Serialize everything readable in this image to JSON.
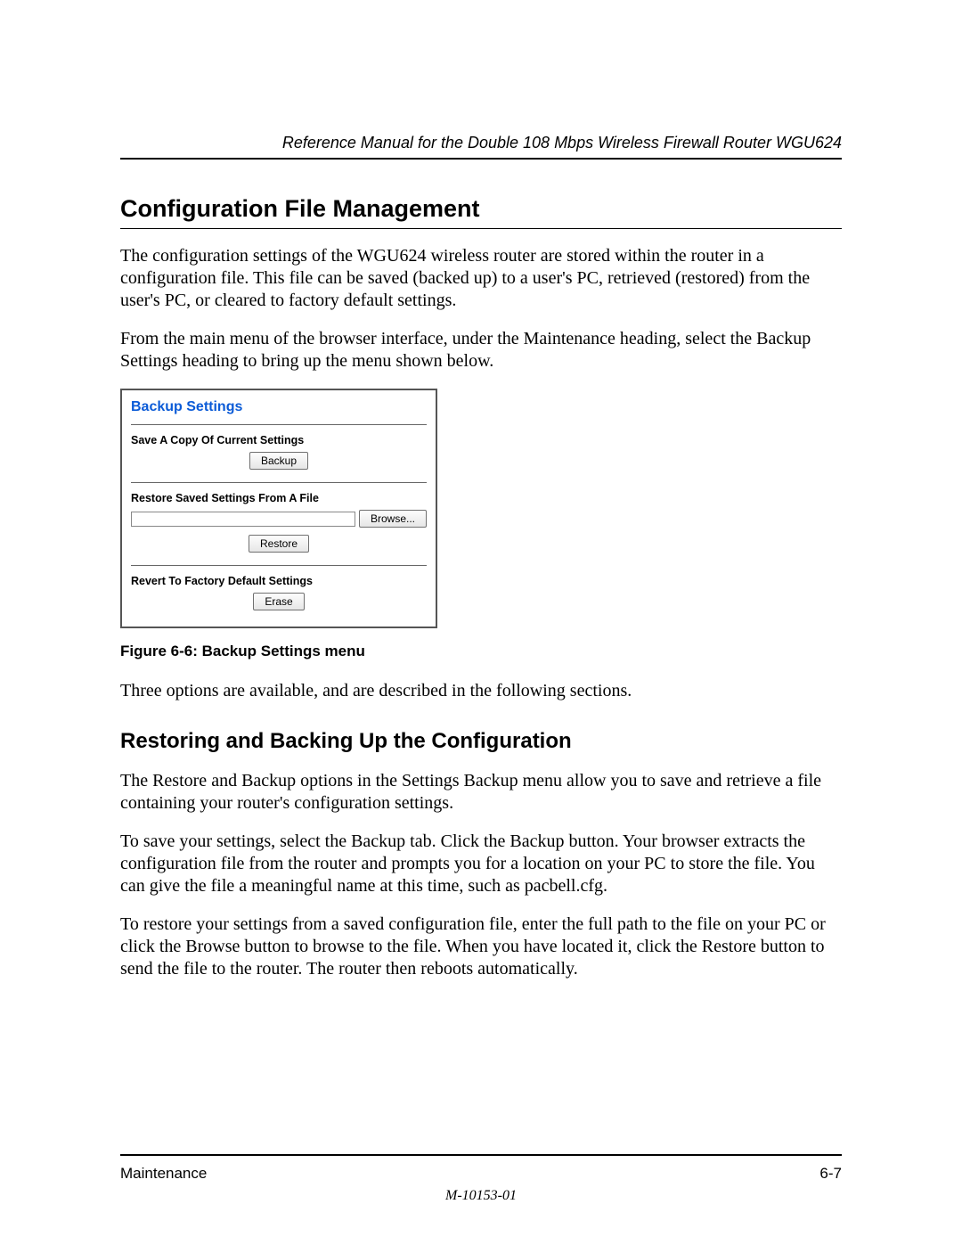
{
  "header": {
    "running_title": "Reference Manual for the Double 108 Mbps Wireless Firewall Router WGU624"
  },
  "section": {
    "title": "Configuration File Management",
    "para1": "The configuration settings of the WGU624 wireless router are stored within the router in a configuration file. This file can be saved (backed up) to a user's PC, retrieved (restored) from the user's PC, or cleared to factory default settings.",
    "para2": "From the main menu of the browser interface, under the Maintenance heading, select the Backup Settings heading to bring up the menu shown below."
  },
  "figure": {
    "panel_title": "Backup Settings",
    "save_label": "Save A Copy Of Current Settings",
    "backup_btn": "Backup",
    "restore_label": "Restore Saved Settings From A File",
    "browse_btn": "Browse...",
    "restore_btn": "Restore",
    "revert_label": "Revert To Factory Default Settings",
    "erase_btn": "Erase",
    "caption": "Figure 6-6:  Backup Settings menu"
  },
  "after_figure": "Three options are available, and are described in the following sections.",
  "subsection": {
    "title": "Restoring and Backing Up the Configuration",
    "para1": "The Restore and Backup options in the Settings Backup menu allow you to save and retrieve a file containing your router's configuration settings.",
    "para2": "To save your settings, select the Backup tab. Click the Backup button. Your browser extracts the configuration file from the router and prompts you for a location on your PC to store the file. You can give the file a meaningful name at this time, such as pacbell.cfg.",
    "para3": "To restore your settings from a saved configuration file, enter the full path to the file on your PC or click the Browse button to browse to the file. When you have located it, click the Restore button to send the file to the router. The router then reboots automatically."
  },
  "footer": {
    "left": "Maintenance",
    "right": "6-7",
    "docnum": "M-10153-01"
  }
}
